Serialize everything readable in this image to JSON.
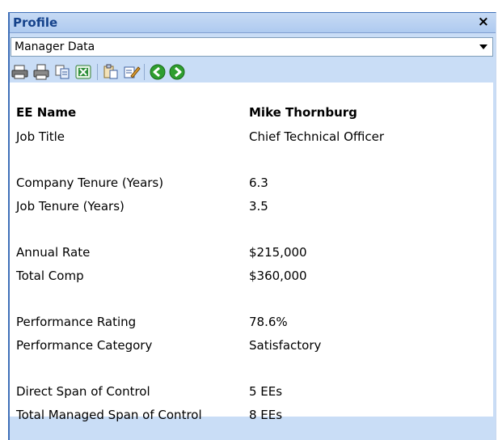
{
  "panel": {
    "title": "Profile",
    "close_label": "×"
  },
  "dropdown": {
    "selected": "Manager Data"
  },
  "toolbar": {
    "icons": [
      "print-icon",
      "print-preview-icon",
      "copy-icon",
      "excel-export-icon",
      "paste-icon",
      "edit-icon",
      "back-icon",
      "forward-icon"
    ]
  },
  "fields": [
    {
      "label": "EE Name",
      "value": "Mike Thornburg"
    },
    {
      "label": "Job Title",
      "value": "Chief Technical Officer"
    },
    {
      "label": "Company Tenure (Years)",
      "value": "6.3"
    },
    {
      "label": "Job Tenure (Years)",
      "value": "3.5"
    },
    {
      "label": "Annual Rate",
      "value": "$215,000"
    },
    {
      "label": "Total Comp",
      "value": "$360,000"
    },
    {
      "label": "Performance Rating",
      "value": "78.6%"
    },
    {
      "label": "Performance Category",
      "value": "Satisfactory"
    },
    {
      "label": "Direct Span of Control",
      "value": "5 EEs"
    },
    {
      "label": "Total Managed Span of Control",
      "value": "8 EEs"
    }
  ]
}
